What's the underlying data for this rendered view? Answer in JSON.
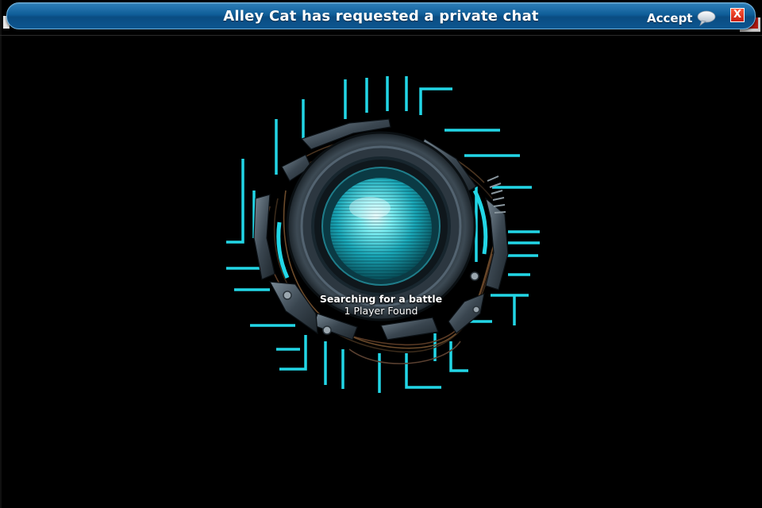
{
  "notification": {
    "message": "Alley Cat has requested a private chat",
    "accept_label": "Accept",
    "close_label": "X"
  },
  "matchmaking": {
    "status": "Searching for a battle",
    "players_found": "1 Player Found"
  },
  "colors": {
    "banner_blue": "#0f5d98",
    "circuit_cyan": "#22d6e6",
    "close_red": "#d42a16"
  }
}
